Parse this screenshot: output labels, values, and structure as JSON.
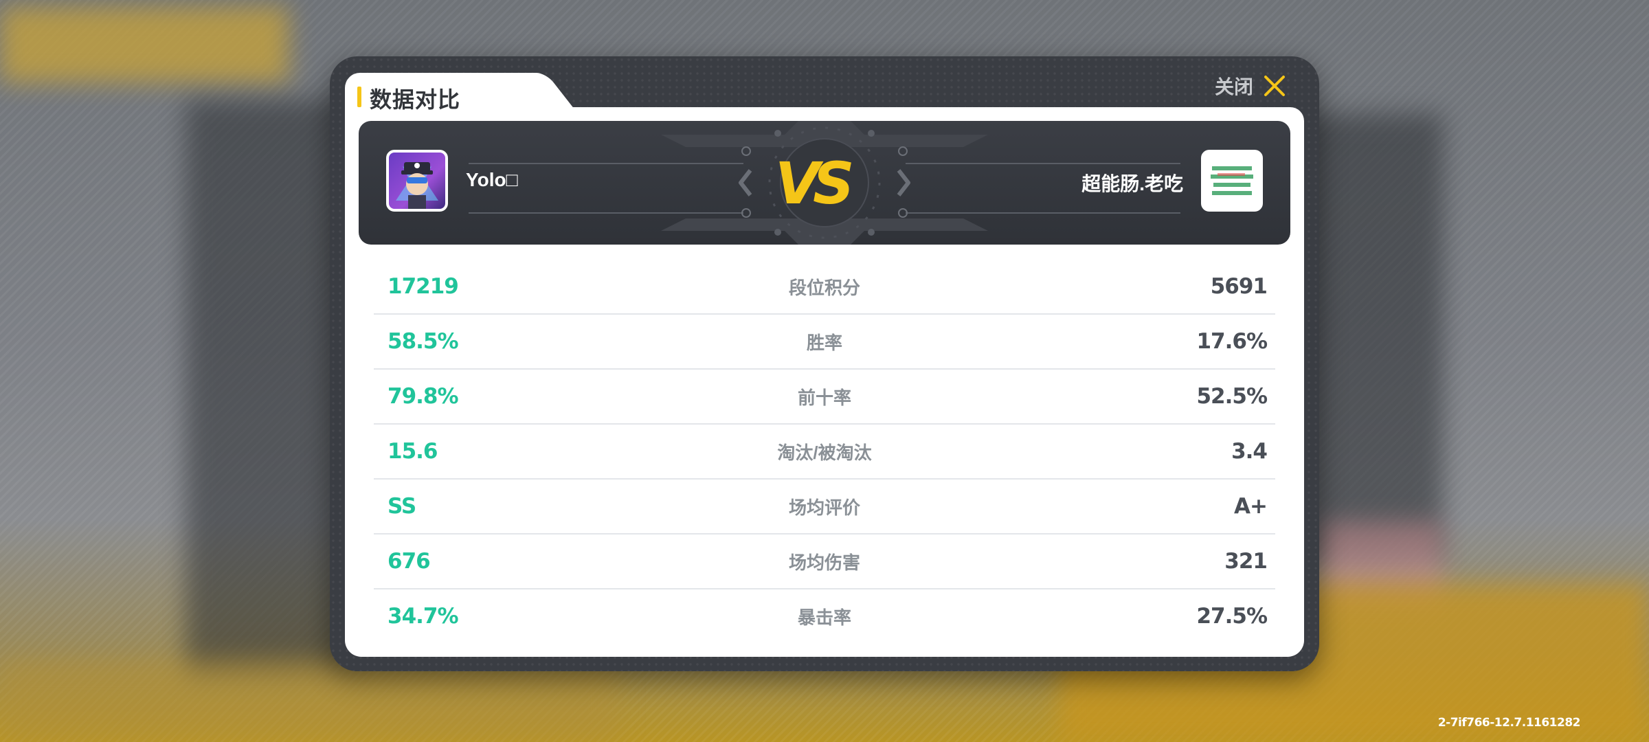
{
  "modal": {
    "title": "数据对比",
    "close_label": "关闭"
  },
  "players": {
    "left": {
      "name": "Yolo□",
      "avatar": "cartoon-pirate-avatar"
    },
    "right": {
      "name": "超能肠.老吃",
      "avatar": "text-meme-avatar"
    },
    "vs_label": "VS"
  },
  "stats": [
    {
      "label": "段位积分",
      "left": "17219",
      "right": "5691"
    },
    {
      "label": "胜率",
      "left": "58.5%",
      "right": "17.6%"
    },
    {
      "label": "前十率",
      "left": "79.8%",
      "right": "52.5%"
    },
    {
      "label": "淘汰/被淘汰",
      "left": "15.6",
      "right": "3.4"
    },
    {
      "label": "场均评价",
      "left": "SS",
      "right": "A+"
    },
    {
      "label": "场均伤害",
      "left": "676",
      "right": "321"
    },
    {
      "label": "暴击率",
      "left": "34.7%",
      "right": "27.5%"
    }
  ],
  "version": "2-7if766-12.7.1161282",
  "colors": {
    "accent_yellow": "#f5c518",
    "left_value": "#20c49a",
    "right_value": "#4a4f57",
    "modal_bg": "#3a3d43"
  }
}
